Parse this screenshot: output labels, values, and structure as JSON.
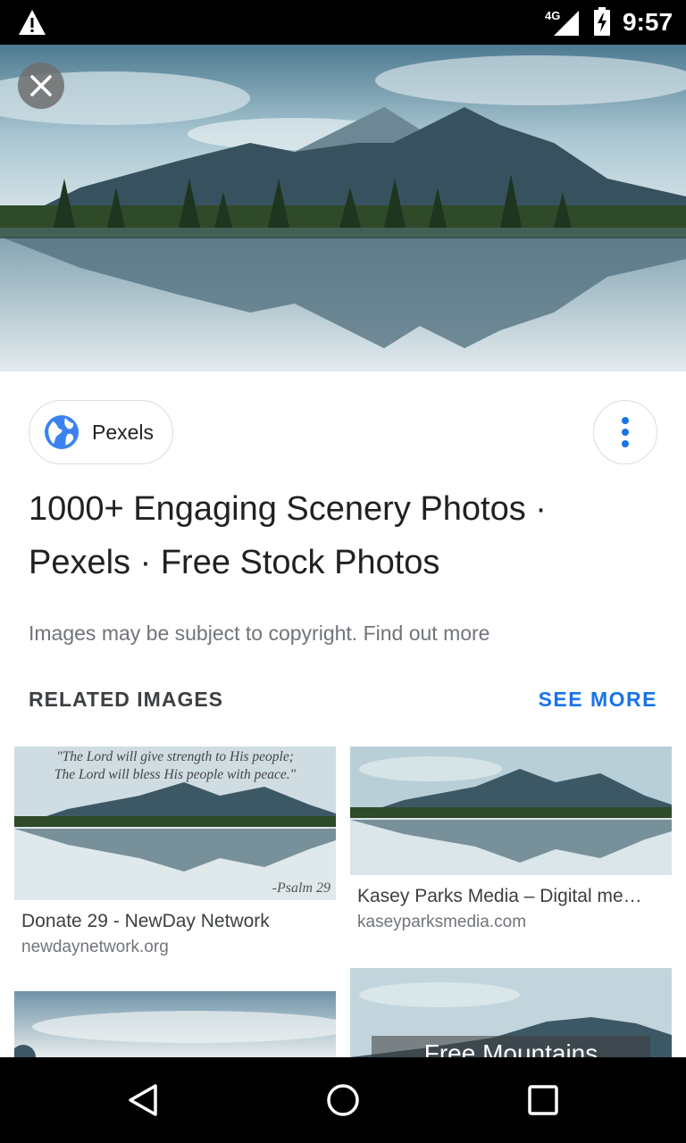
{
  "status_bar": {
    "time": "9:57",
    "network": "4G",
    "icons": [
      "warning-icon",
      "signal-icon",
      "battery-charging-icon"
    ]
  },
  "viewer": {
    "close_icon": "close-icon"
  },
  "source_chip": {
    "label": "Pexels",
    "icon": "globe-icon"
  },
  "more_icon": "more-vert-icon",
  "title": "1000+ Engaging Scenery Photos · Pexels · Free Stock Photos",
  "copyright": {
    "text": "Images may be subject to copyright. Find out more"
  },
  "related": {
    "heading": "RELATED IMAGES",
    "see_more": "SEE MORE",
    "items": [
      {
        "title": "Donate 29 - NewDay Network",
        "source": "newdaynetwork.org",
        "overlay_quote_1": "\"The Lord will give strength to His people;",
        "overlay_quote_2": "The Lord will bless His people with peace.\"",
        "overlay_ref": "-Psalm 29"
      },
      {
        "title": "Kasey Parks Media – Digital me…",
        "source": "kaseyparksmedia.com"
      },
      {
        "title": "",
        "source": ""
      },
      {
        "title": "",
        "source": "",
        "overlay_text": "Free Mountains"
      }
    ]
  },
  "nav_bar": {
    "icons": [
      "back-icon",
      "home-icon",
      "recents-icon"
    ]
  }
}
